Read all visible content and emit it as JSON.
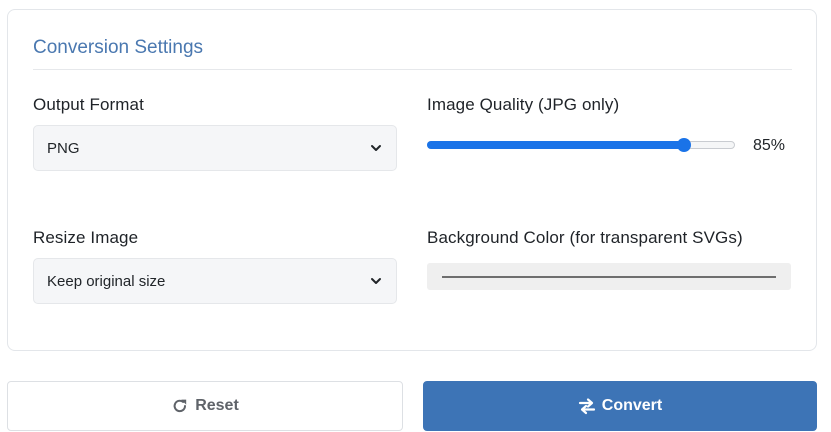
{
  "panel": {
    "title": "Conversion Settings"
  },
  "output_format": {
    "label": "Output Format",
    "selected": "PNG"
  },
  "image_quality": {
    "label": "Image Quality (JPG only)",
    "value": 85,
    "display": "85%"
  },
  "resize": {
    "label": "Resize Image",
    "selected": "Keep original size"
  },
  "background_color": {
    "label": "Background Color (for transparent SVGs)",
    "value": "#6e6e6e"
  },
  "buttons": {
    "reset_label": "Reset",
    "reset_icon": "redo-icon",
    "convert_label": "Convert",
    "convert_icon": "exchange-icon"
  },
  "colors": {
    "accent": "#3d74b6",
    "slider": "#1a73e8",
    "title": "#4a78b0"
  }
}
